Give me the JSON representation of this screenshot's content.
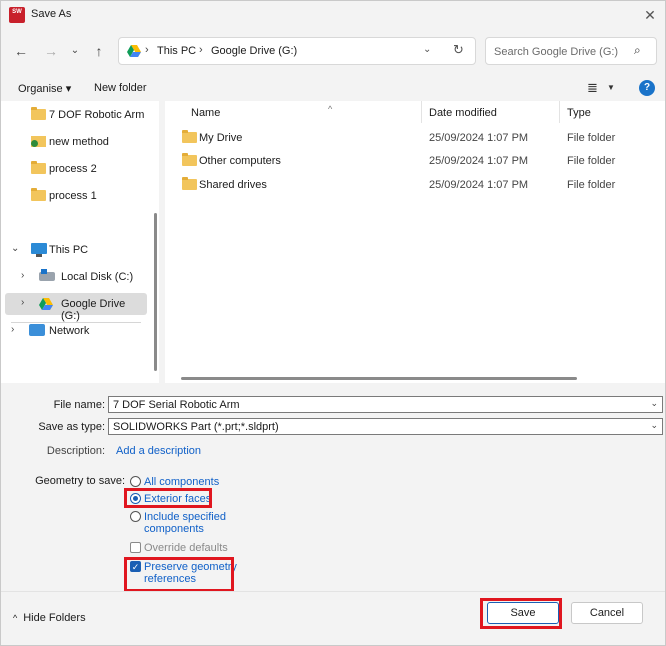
{
  "window": {
    "title": "Save As",
    "app_icon_text": "SW"
  },
  "address_bar": {
    "crumbs": [
      "This PC",
      "Google Drive (G:)"
    ],
    "search_placeholder": "Search Google Drive (G:)"
  },
  "toolbar": {
    "organise": "Organise ▾",
    "new_folder": "New folder"
  },
  "nav": {
    "items": [
      {
        "label": "7 DOF Robotic Arm"
      },
      {
        "label": "new method"
      },
      {
        "label": "process 2"
      },
      {
        "label": "process 1"
      },
      {
        "label": "This PC"
      },
      {
        "label": "Local Disk (C:)"
      },
      {
        "label": "Google Drive (G:)"
      },
      {
        "label": "Network"
      }
    ]
  },
  "file_list": {
    "columns": [
      "Name",
      "Date modified",
      "Type"
    ],
    "rows": [
      {
        "name": "My Drive",
        "date": "25/09/2024 1:07 PM",
        "type": "File folder"
      },
      {
        "name": "Other computers",
        "date": "25/09/2024 1:07 PM",
        "type": "File folder"
      },
      {
        "name": "Shared drives",
        "date": "25/09/2024 1:07 PM",
        "type": "File folder"
      }
    ]
  },
  "form": {
    "file_name_label": "File name:",
    "file_name_value": "7 DOF Serial Robotic Arm",
    "save_type_label": "Save as type:",
    "save_type_value": "SOLIDWORKS Part (*.prt;*.sldprt)",
    "description_label": "Description:",
    "description_link": "Add a description",
    "geometry_label": "Geometry to save:",
    "opt_all": "All components",
    "opt_exterior": "Exterior faces",
    "opt_include_1": "Include specified",
    "opt_include_2": "components",
    "opt_override": "Override defaults",
    "opt_preserve_1": "Preserve geometry",
    "opt_preserve_2": "references"
  },
  "footer": {
    "hide_folders": "Hide Folders",
    "save": "Save",
    "cancel": "Cancel"
  },
  "colors": {
    "highlight_box": "#e0161f",
    "link": "#1060c8",
    "accent": "#1a5fb4"
  }
}
